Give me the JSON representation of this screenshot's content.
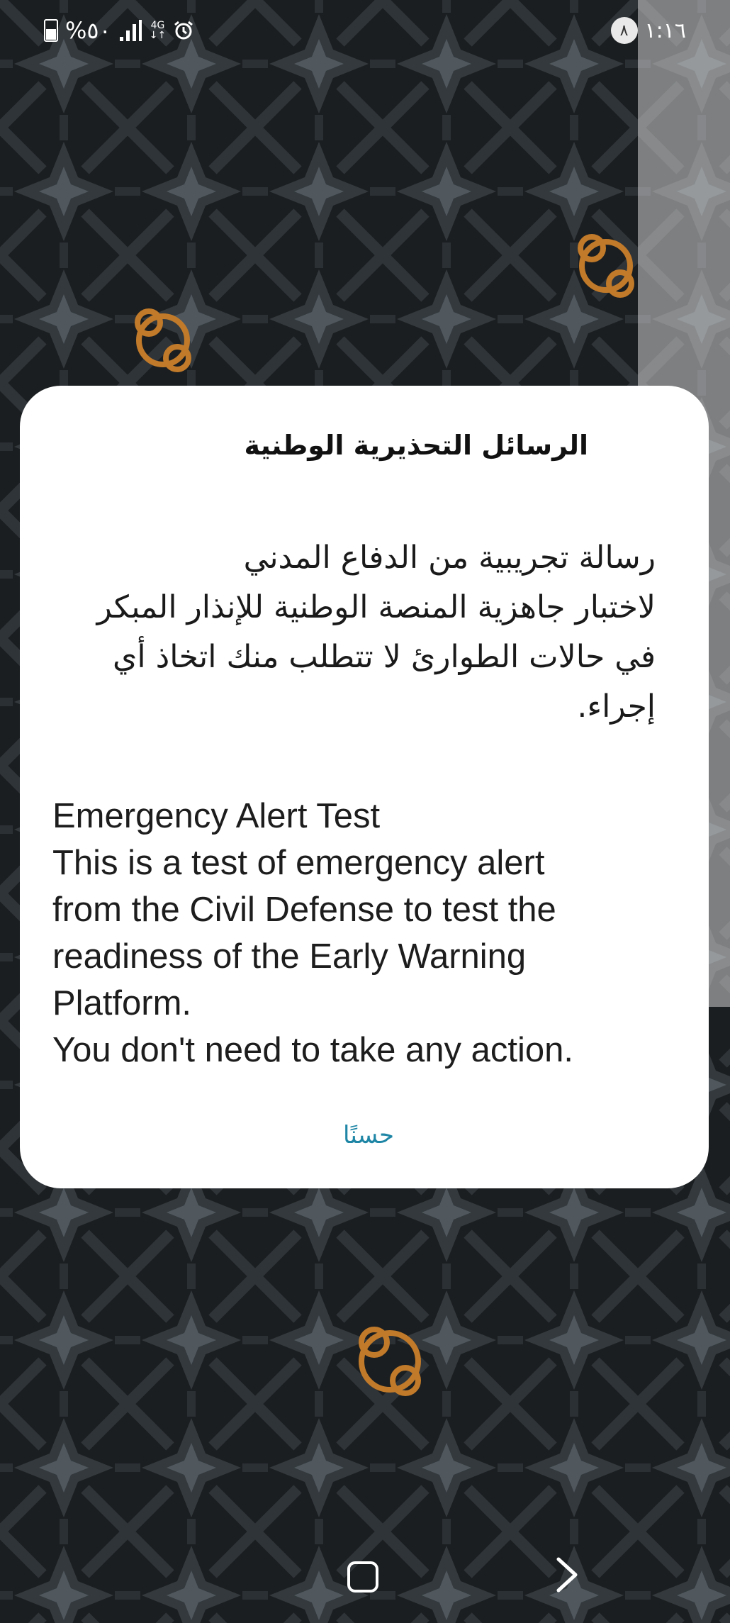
{
  "statusbar": {
    "time": "١:١٦",
    "notification_badge": "٨",
    "battery_percent": "%٥٠",
    "network_type": "4G",
    "network_arrows": "↓↑",
    "signal_icon": "signal-bars-icon",
    "alarm_icon": "alarm-icon",
    "battery_icon": "battery-icon"
  },
  "dialog": {
    "title": "الرسائل التحذيرية الوطنية",
    "arabic_lines": [
      "رسالة تجريبية من الدفاع المدني",
      "لاختبار جاهزية المنصة الوطنية للإنذار المبكر",
      "في حالات الطوارئ لا تتطلب منك اتخاذ أي",
      "إجراء."
    ],
    "english_lines": [
      "Emergency Alert Test",
      "This is a test of emergency alert",
      "from the Civil Defense to test the",
      "readiness of the Early Warning",
      "Platform.",
      "You don't need to take any action."
    ],
    "ok_label": "حسنًا",
    "ok_color": "#1f86a6"
  },
  "navbar": {
    "home_icon": "home-icon",
    "back_icon": "chevron-right-icon"
  }
}
